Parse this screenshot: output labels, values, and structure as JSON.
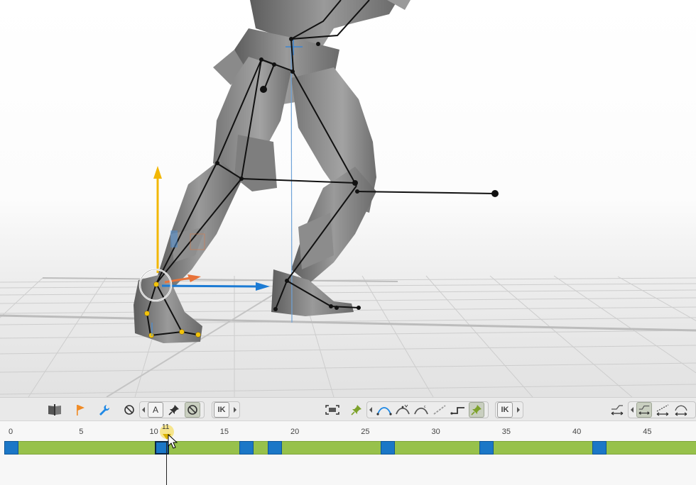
{
  "viewport": {
    "scene": "3d-character-rig-viewport",
    "background_top": "#ffffff",
    "floor_color": "#e3e3e3",
    "gizmo_y_color": "#f2b705",
    "gizmo_x_color": "#1c7bd4",
    "gizmo_z_color": "#e8733a"
  },
  "toolbar": {
    "left_icons": [
      "book-icon",
      "flag-icon",
      "wrench-icon",
      "no-icon"
    ],
    "key_group": [
      "auto-key-icon",
      "pin-icon",
      "no-icon"
    ],
    "key_group_letter": "A",
    "ik_label_1": "IK",
    "center_icons": [
      "frame-icon",
      "pin-icon"
    ],
    "curve_icons": [
      "curve-auto-icon",
      "curve-vertex-icon",
      "curve-clamped-icon",
      "curve-linear-icon",
      "curve-step-icon",
      "pin-active-icon"
    ],
    "ik_label_2": "IK",
    "right_icons": [
      "infinity-pre-icon",
      "infinity-cycle-icon",
      "infinity-linear-icon",
      "infinity-oscillate-icon"
    ],
    "accent_orange": "#f08a24",
    "accent_blue": "#1e88e5",
    "accent_green": "#7da22b"
  },
  "timeline": {
    "ticks": [
      "0",
      "5",
      "10",
      "15",
      "20",
      "25",
      "30",
      "35",
      "40",
      "45"
    ],
    "current_frame": "11",
    "keyframes": [
      0,
      11,
      17,
      19,
      27,
      34,
      42
    ],
    "selected_keyframe": 11,
    "track_color": "#97c14b",
    "key_color": "#1b77c7"
  }
}
